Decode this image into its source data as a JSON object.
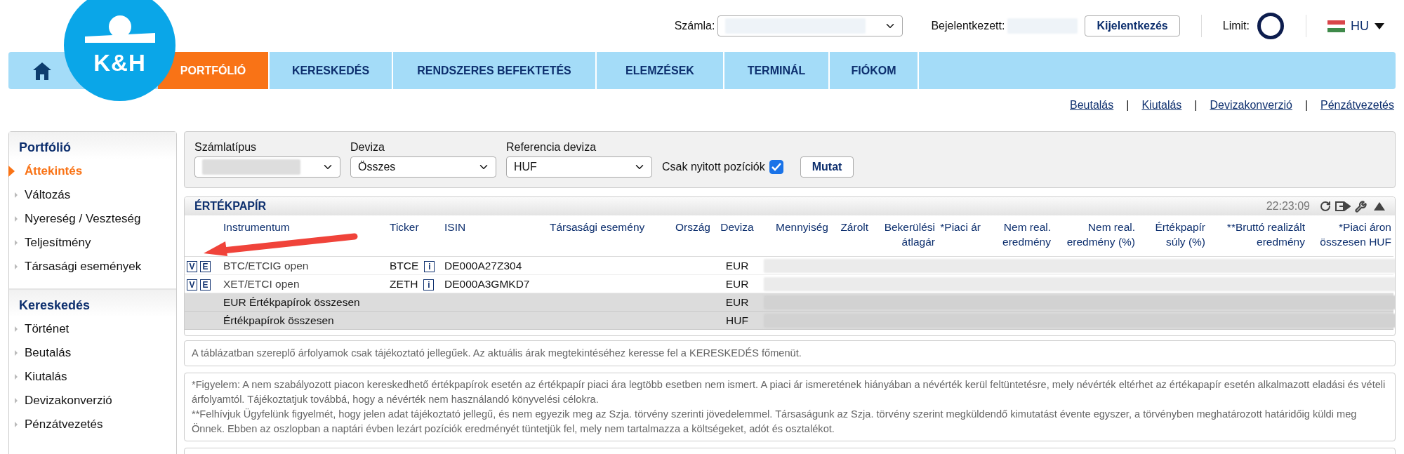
{
  "header": {
    "account_label": "Számla:",
    "logged_in_label": "Bejelentkezett:",
    "logout_button": "Kijelentkezés",
    "limit_label": "Limit:",
    "language": "HU"
  },
  "logo": {
    "text": "K&H"
  },
  "nav": {
    "items": [
      {
        "label": "PORTFÓLIÓ",
        "selected": true
      },
      {
        "label": "KERESKEDÉS",
        "selected": false
      },
      {
        "label": "RENDSZERES BEFEKTETÉS",
        "selected": false
      },
      {
        "label": "ELEMZÉSEK",
        "selected": false
      },
      {
        "label": "TERMINÁL",
        "selected": false
      },
      {
        "label": "FIÓKOM",
        "selected": false
      }
    ]
  },
  "quick_links": [
    "Beutalás",
    "Kiutalás",
    "Devizakonverzió",
    "Pénzátvezetés"
  ],
  "link_separators": [
    "|",
    "|",
    "|"
  ],
  "sidebar": {
    "sections": [
      {
        "title": "Portfólió",
        "items": [
          {
            "label": "Áttekintés",
            "selected": true
          },
          {
            "label": "Változás",
            "selected": false
          },
          {
            "label": "Nyereség / Veszteség",
            "selected": false
          },
          {
            "label": "Teljesítmény",
            "selected": false
          },
          {
            "label": "Társasági események",
            "selected": false
          }
        ]
      },
      {
        "title": "Kereskedés",
        "items": [
          {
            "label": "Történet",
            "selected": false
          },
          {
            "label": "Beutalás",
            "selected": false
          },
          {
            "label": "Kiutalás",
            "selected": false
          },
          {
            "label": "Devizakonverzió",
            "selected": false
          },
          {
            "label": "Pénzátvezetés",
            "selected": false
          }
        ]
      }
    ]
  },
  "filters": {
    "account_type": {
      "label": "Számlatípus"
    },
    "currency": {
      "label": "Deviza",
      "value": "Összes"
    },
    "reference_currency": {
      "label": "Referencia deviza",
      "value": "HUF"
    },
    "open_only": {
      "label": "Csak nyitott pozíciók",
      "checked": true
    },
    "show_button": "Mutat"
  },
  "securities": {
    "title": "ÉRTÉKPAPÍR",
    "time": "22:23:09",
    "columns": [
      "Instrumentum",
      "Ticker",
      "ISIN",
      "Társasági esemény",
      "Ország",
      "Deviza",
      "Mennyiség",
      "Zárolt",
      "Bekerülési átlagár",
      "*Piaci ár",
      "Nem real. eredmény",
      "Nem real. eredmény (%)",
      "Értékpapír súly (%)",
      "**Bruttó realizált eredmény",
      "*Piaci áron összesen HUF"
    ],
    "rows": [
      {
        "kind": "position",
        "view": "V",
        "edit": "E",
        "instrument": "BTC/ETCIG open",
        "ticker": "BTCE",
        "info": "i",
        "isin": "DE000A27Z304",
        "currency": "EUR"
      },
      {
        "kind": "position",
        "view": "V",
        "edit": "E",
        "instrument": "XET/ETCI open",
        "ticker": "ZETH",
        "info": "i",
        "isin": "DE000A3GMKD7",
        "currency": "EUR"
      },
      {
        "kind": "total",
        "instrument": "EUR Értékpapírok összesen",
        "currency": "EUR"
      },
      {
        "kind": "total",
        "instrument": "Értékpapírok összesen",
        "currency": "HUF"
      }
    ]
  },
  "notes": [
    "A táblázatban szereplő árfolyamok csak tájékoztató jellegűek. Az aktuális árak megtekintéséhez keresse fel a KERESKEDÉS főmenüt.",
    "*Figyelem: A nem szabályozott piacon kereskedhető értékpapírok esetén az értékpapír piaci ára legtöbb esetben nem ismert. A piaci ár ismeretének hiányában a névérték kerül feltüntetésre, mely névérték eltérhet az értékapapír esetén alkalmazott eladási és vételi árfolyamtól. Tájékoztatjuk továbbá, hogy a névérték nem használandó könyvelési célokra.",
    "**Felhívjuk Ügyfelünk figyelmét, hogy jelen adat tájékoztató jellegű, és nem egyezik meg az Szja. törvény szerinti jövedelemmel. Társaságunk az Szja. törvény szerint megküldendő kimutatást évente egyszer, a törvényben meghatározott határidőig küldi meg Önnek. Ebben az oszlopban a naptári évben lezárt pozíciók eredményét tüntetjük fel, mely nem tartalmazza a költségeket, adót és osztalékot."
  ]
}
